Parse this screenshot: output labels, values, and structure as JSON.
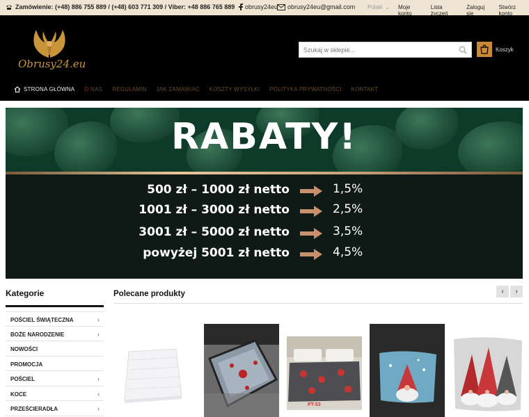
{
  "topbar": {
    "phone": "Zamówienie: (+48) 886 755 889 / (+48) 603 771 309 / Viber: +48 886 765 889",
    "facebook": "obrusy24eu",
    "email": "obrusy24eu@gmail.com",
    "language": "Polski",
    "links": [
      "Moje konto",
      "Lista życzeń",
      "Zaloguj się",
      "Stwórz konto"
    ]
  },
  "header": {
    "logo_text": "Obrusy24.eu",
    "search_placeholder": "Szukaj w sklepie...",
    "cart_label": "Koszyk"
  },
  "nav": {
    "home": "Strona główna",
    "items": [
      "O nas",
      "Regulamin",
      "Jak zamawiać",
      "Koszty wysyłki",
      "Polityka prywatności",
      "Kontakt"
    ]
  },
  "banner": {
    "title": "RABATY!",
    "rows": [
      {
        "range": "500 zł – 1000 zł netto",
        "pct": "1,5%"
      },
      {
        "range": "1001 zł – 3000 zł netto",
        "pct": "2,5%"
      },
      {
        "range": "3001 zł – 5000 zł netto",
        "pct": "3,5%"
      },
      {
        "range": "powyżej 5001 zł netto",
        "pct": "4,5%"
      }
    ]
  },
  "categories": {
    "heading": "Kategorie",
    "items": [
      {
        "label": "POŚCIEL ŚWIĄTECZNA",
        "has_sub": true
      },
      {
        "label": "BOŻE NARODZENIE",
        "has_sub": true
      },
      {
        "label": "NOWOŚCI",
        "has_sub": false
      },
      {
        "label": "PROMOCJA",
        "has_sub": false
      },
      {
        "label": "POŚCIEL",
        "has_sub": true
      },
      {
        "label": "KOCE",
        "has_sub": true
      },
      {
        "label": "PRZEŚCIERADŁA",
        "has_sub": true
      }
    ]
  },
  "products": {
    "heading": "Polecane produkty",
    "prev": "‹",
    "next": "›",
    "badge_text": "PT-53"
  },
  "colors": {
    "topbar_bg": "#f0e5d2",
    "header_bg": "#000000",
    "accent_gold": "#c98a38",
    "nav_text": "#6b4a28"
  }
}
